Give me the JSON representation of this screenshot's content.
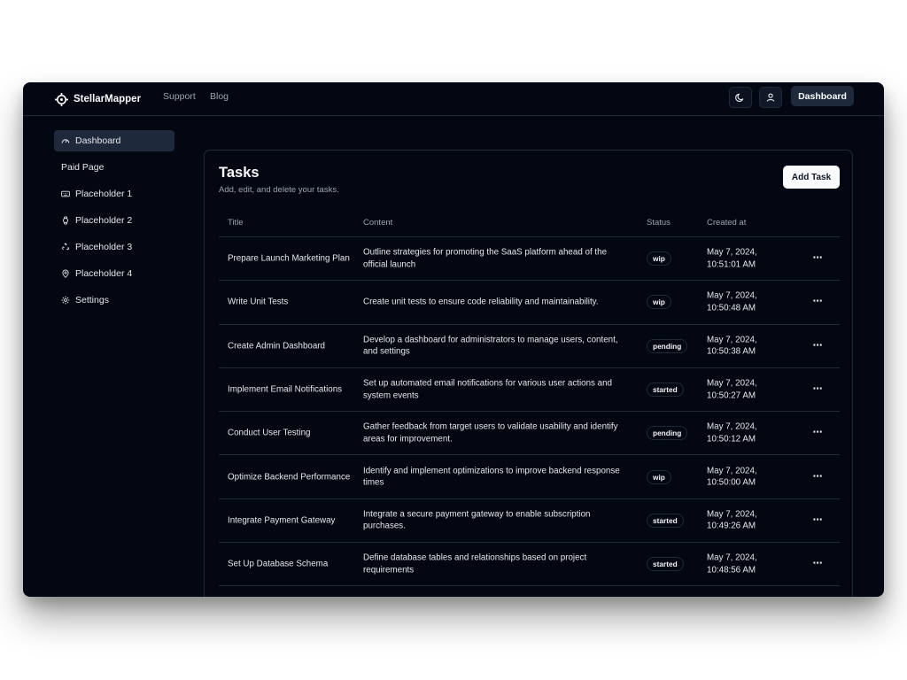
{
  "app": {
    "brand": "StellarMapper",
    "nav": [
      "Support",
      "Blog"
    ],
    "dashboard_button": "Dashboard"
  },
  "sidebar": {
    "items": [
      {
        "label": "Dashboard",
        "icon": "gauge-icon",
        "active": true
      },
      {
        "label": "Paid Page",
        "icon": "",
        "active": false
      },
      {
        "label": "Placeholder 1",
        "icon": "keyboard-icon",
        "active": false
      },
      {
        "label": "Placeholder 2",
        "icon": "watch-icon",
        "active": false
      },
      {
        "label": "Placeholder 3",
        "icon": "recycle-icon",
        "active": false
      },
      {
        "label": "Placeholder 4",
        "icon": "map-pin-icon",
        "active": false
      },
      {
        "label": "Settings",
        "icon": "gear-icon",
        "active": false
      }
    ]
  },
  "tasks": {
    "title": "Tasks",
    "subtitle": "Add, edit, and delete your tasks.",
    "add_button": "Add Task",
    "columns": {
      "title": "Title",
      "content": "Content",
      "status": "Status",
      "created": "Created at"
    },
    "rows": [
      {
        "title": "Prepare Launch Marketing Plan",
        "content": "Outline strategies for promoting the SaaS platform ahead of the official launch",
        "status": "wip",
        "created": "May 7, 2024, 10:51:01 AM"
      },
      {
        "title": "Write Unit Tests",
        "content": "Create unit tests to ensure code reliability and maintainability.",
        "status": "wip",
        "created": "May 7, 2024, 10:50:48 AM"
      },
      {
        "title": "Create Admin Dashboard",
        "content": "Develop a dashboard for administrators to manage users, content, and settings",
        "status": "pending",
        "created": "May 7, 2024, 10:50:38 AM"
      },
      {
        "title": "Implement Email Notifications",
        "content": "Set up automated email notifications for various user actions and system events",
        "status": "started",
        "created": "May 7, 2024, 10:50:27 AM"
      },
      {
        "title": "Conduct User Testing",
        "content": "Gather feedback from target users to validate usability and identify areas for improvement.",
        "status": "pending",
        "created": "May 7, 2024, 10:50:12 AM"
      },
      {
        "title": "Optimize Backend Performance",
        "content": "Identify and implement optimizations to improve backend response times",
        "status": "wip",
        "created": "May 7, 2024, 10:50:00 AM"
      },
      {
        "title": "Integrate Payment Gateway",
        "content": "Integrate a secure payment gateway to enable subscription purchases.",
        "status": "started",
        "created": "May 7, 2024, 10:49:26 AM"
      },
      {
        "title": "Set Up Database Schema",
        "content": "Define database tables and relationships based on project requirements",
        "status": "started",
        "created": "May 7, 2024, 10:48:56 AM"
      }
    ],
    "row_action": "⋯"
  }
}
